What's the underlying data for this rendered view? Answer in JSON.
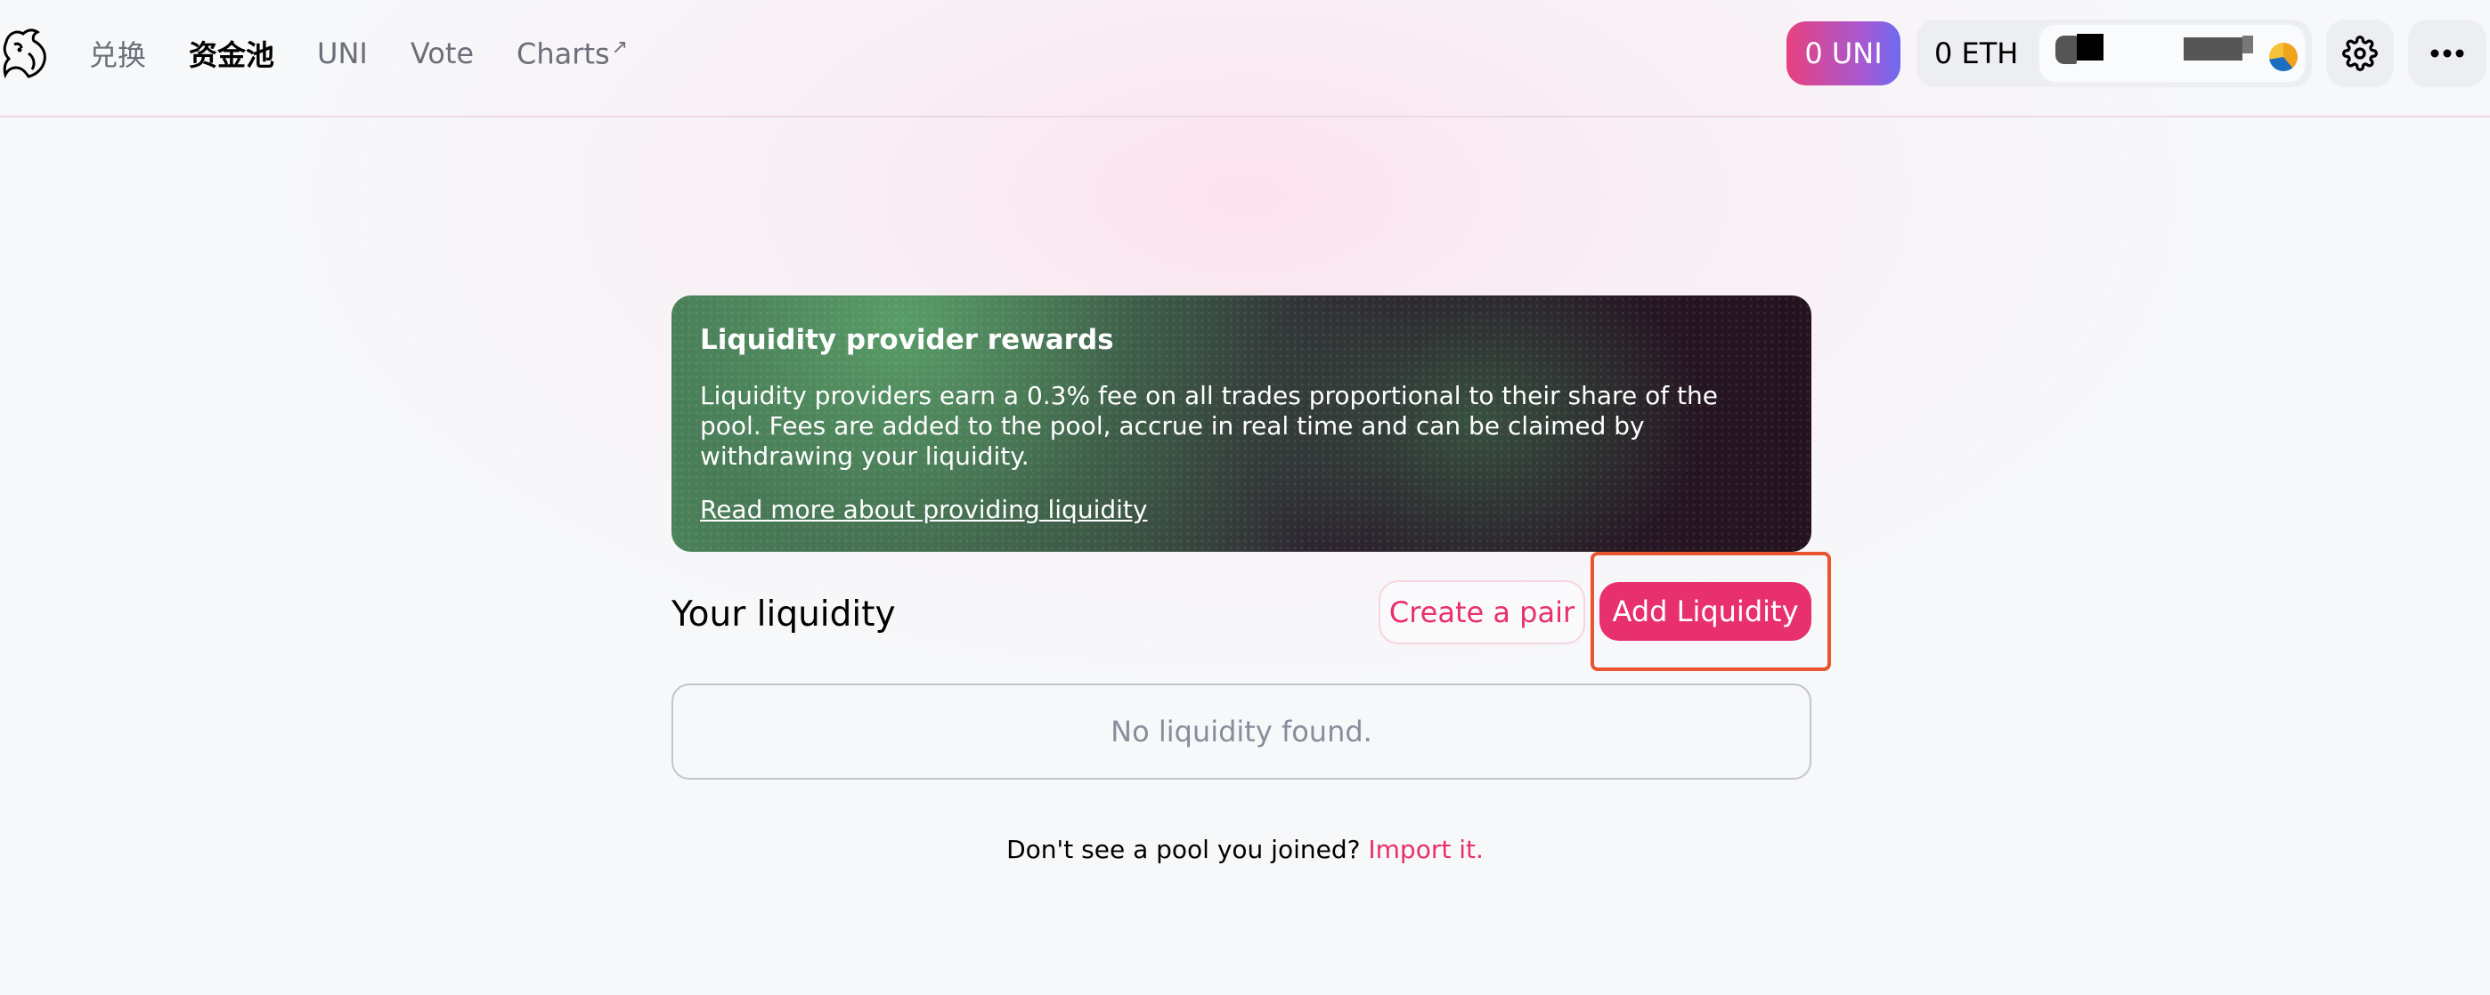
{
  "header": {
    "nav": [
      {
        "label": "兑换",
        "active": false
      },
      {
        "label": "资金池",
        "active": true
      },
      {
        "label": "UNI",
        "active": false
      },
      {
        "label": "Vote",
        "active": false
      },
      {
        "label": "Charts",
        "active": false,
        "external": true
      }
    ],
    "external_arrow": "↗",
    "uni_badge": "0 UNI",
    "eth_balance": "0 ETH",
    "icons": {
      "logo": "unicorn-logo-icon",
      "settings": "gear-icon",
      "more": "more-dots-icon"
    }
  },
  "banner": {
    "title": "Liquidity provider rewards",
    "body": "Liquidity providers earn a 0.3% fee on all trades proportional to their share of the pool. Fees are added to the pool, accrue in real time and can be claimed by withdrawing your liquidity.",
    "link": "Read more about providing liquidity"
  },
  "liquidity": {
    "heading": "Your liquidity",
    "create_pair": "Create a pair",
    "add_liquidity": "Add Liquidity",
    "empty": "No liquidity found."
  },
  "import": {
    "prompt": "Don't see a pool you joined?",
    "link": "Import it."
  },
  "colors": {
    "accent": "#e8306f",
    "highlight_outline": "#e8552f"
  }
}
